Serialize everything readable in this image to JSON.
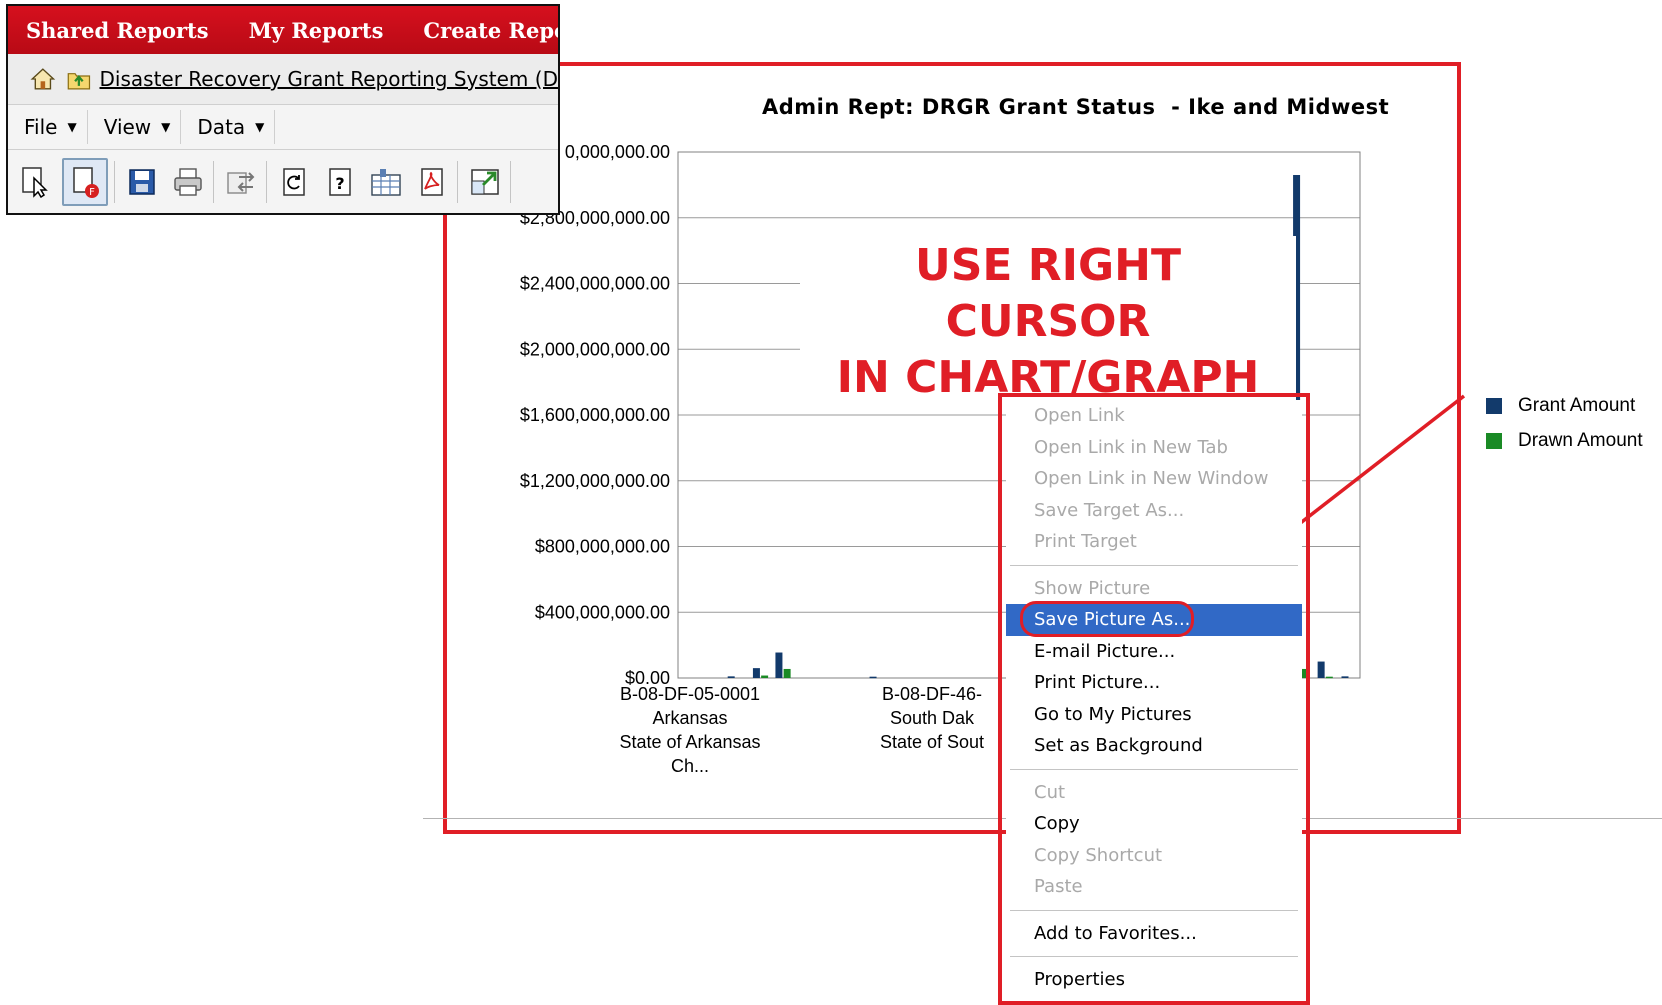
{
  "app": {
    "tabs": [
      "Shared Reports",
      "My Reports",
      "Create Repor"
    ],
    "breadcrumb": "Disaster Recovery Grant Reporting System (D",
    "menus": [
      "File",
      "View",
      "Data"
    ]
  },
  "overlay_text": {
    "line1": "USE RIGHT CURSOR",
    "line2": "IN CHART/GRAPH"
  },
  "chart_data": {
    "type": "bar",
    "title": "Admin Rept: DRGR Grant Status  - Ike and Midwest",
    "ytick_labels": [
      "$0.00",
      "$400,000,000.00",
      "$800,000,000.00",
      "$1,200,000,000.00",
      "$1,600,000,000.00",
      "$2,000,000,000.00",
      "$2,400,000,000.00",
      "$2,800,000,000.00",
      "0,000,000.00"
    ],
    "ylim": [
      0,
      3200000000
    ],
    "category_labels": [
      [
        "B-08-DF-05-0001",
        "Arkansas",
        "State of Arkansas",
        "Ch..."
      ],
      [
        "B-08-DF-46-",
        "South Dak",
        "State of Sout"
      ]
    ],
    "series": [
      {
        "name": "Grant Amount",
        "color": "#123a6b"
      },
      {
        "name": "Drawn Amount",
        "color": "#1a8a25"
      }
    ],
    "bars": [
      {
        "series": 0,
        "x": 0.078,
        "value": 10000000
      },
      {
        "series": 0,
        "x": 0.115,
        "value": 60000000
      },
      {
        "series": 1,
        "x": 0.127,
        "value": 15000000
      },
      {
        "series": 0,
        "x": 0.148,
        "value": 155000000
      },
      {
        "series": 1,
        "x": 0.16,
        "value": 55000000
      },
      {
        "series": 0,
        "x": 0.286,
        "value": 8000000
      },
      {
        "series": 0,
        "x": 0.907,
        "value": 3060000000
      },
      {
        "series": 1,
        "x": 0.92,
        "value": 55000000
      },
      {
        "series": 0,
        "x": 0.943,
        "value": 100000000
      },
      {
        "series": 1,
        "x": 0.955,
        "value": 8000000
      },
      {
        "series": 0,
        "x": 0.978,
        "value": 10000000
      }
    ],
    "legend": "right",
    "grid": true
  },
  "context_menu": {
    "groups": [
      [
        {
          "label": "Open Link",
          "enabled": false
        },
        {
          "label": "Open Link in New Tab",
          "enabled": false
        },
        {
          "label": "Open Link in New Window",
          "enabled": false
        },
        {
          "label": "Save Target As...",
          "enabled": false
        },
        {
          "label": "Print Target",
          "enabled": false
        }
      ],
      [
        {
          "label": "Show Picture",
          "enabled": false
        },
        {
          "label": "Save Picture As...",
          "enabled": true,
          "highlight": true
        },
        {
          "label": "E-mail Picture...",
          "enabled": true
        },
        {
          "label": "Print Picture...",
          "enabled": true
        },
        {
          "label": "Go to My Pictures",
          "enabled": true
        },
        {
          "label": "Set as Background",
          "enabled": true
        }
      ],
      [
        {
          "label": "Cut",
          "enabled": false
        },
        {
          "label": "Copy",
          "enabled": true
        },
        {
          "label": "Copy Shortcut",
          "enabled": false
        },
        {
          "label": "Paste",
          "enabled": false
        }
      ],
      [
        {
          "label": "Add to Favorites...",
          "enabled": true
        }
      ],
      [
        {
          "label": "Properties",
          "enabled": true
        }
      ]
    ]
  },
  "colors": {
    "annotation_red": "#e01e26",
    "menu_highlight": "#3169c6",
    "tab_bar_red": "#c80d19"
  }
}
